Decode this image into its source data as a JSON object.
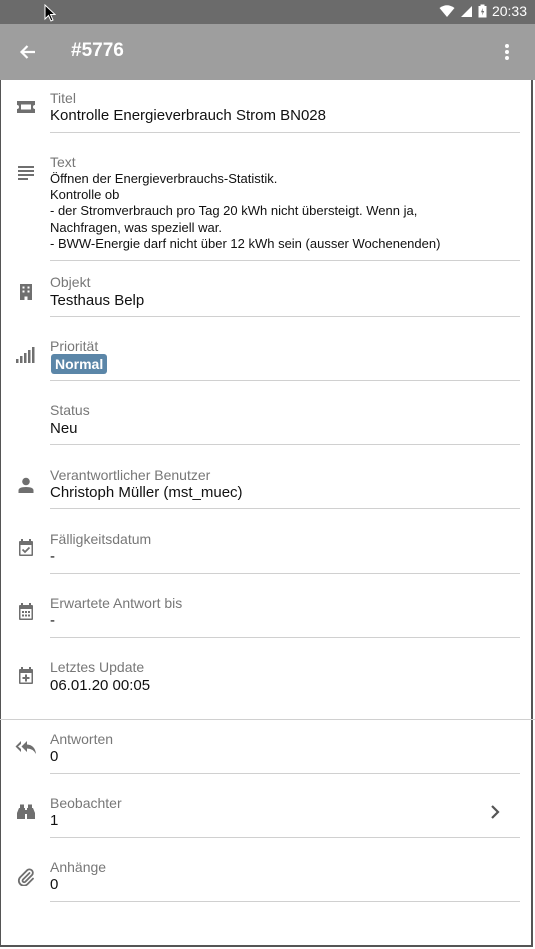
{
  "statusbar": {
    "time": "20:33"
  },
  "appbar": {
    "title": "#5776"
  },
  "fields": {
    "titel": {
      "label": "Titel",
      "value": "Kontrolle Energieverbrauch Strom BN028"
    },
    "text": {
      "label": "Text",
      "value": "Öffnen der Energieverbrauchs-Statistik.\nKontrolle ob\n - der Stromverbrauch pro Tag 20 kWh nicht übersteigt. Wenn ja,\nNachfragen, was speziell war.\n - BWW-Energie darf nicht über 12 kWh sein (ausser Wochenenden)"
    },
    "objekt": {
      "label": "Objekt",
      "value": "Testhaus Belp"
    },
    "prioritaet": {
      "label": "Priorität",
      "value": "Normal"
    },
    "status": {
      "label": "Status",
      "value": "Neu"
    },
    "benutzer": {
      "label": "Verantwortlicher Benutzer",
      "value": "Christoph Müller (mst_muec)"
    },
    "faelligkeit": {
      "label": "Fälligkeitsdatum",
      "value": "-"
    },
    "antwort_bis": {
      "label": "Erwartete Antwort bis",
      "value": "-"
    },
    "update": {
      "label": "Letztes Update",
      "value": "06.01.20 00:05"
    },
    "antworten": {
      "label": "Antworten",
      "value": "0"
    },
    "beobachter": {
      "label": "Beobachter",
      "value": "1"
    },
    "anhaenge": {
      "label": "Anhänge",
      "value": "0"
    }
  },
  "colors": {
    "appbar": "#9e9e9e",
    "statusbar": "#6b6b6b",
    "badge": "#5b86a8",
    "icon": "#6f6f6f"
  },
  "icons": [
    "ticket-icon",
    "text-lines-icon",
    "building-icon",
    "signal-icon",
    "person-icon",
    "calendar-check-icon",
    "calendar-icon",
    "calendar-plus-icon",
    "reply-all-icon",
    "binoculars-icon",
    "paperclip-icon",
    "chevron-right-icon"
  ]
}
